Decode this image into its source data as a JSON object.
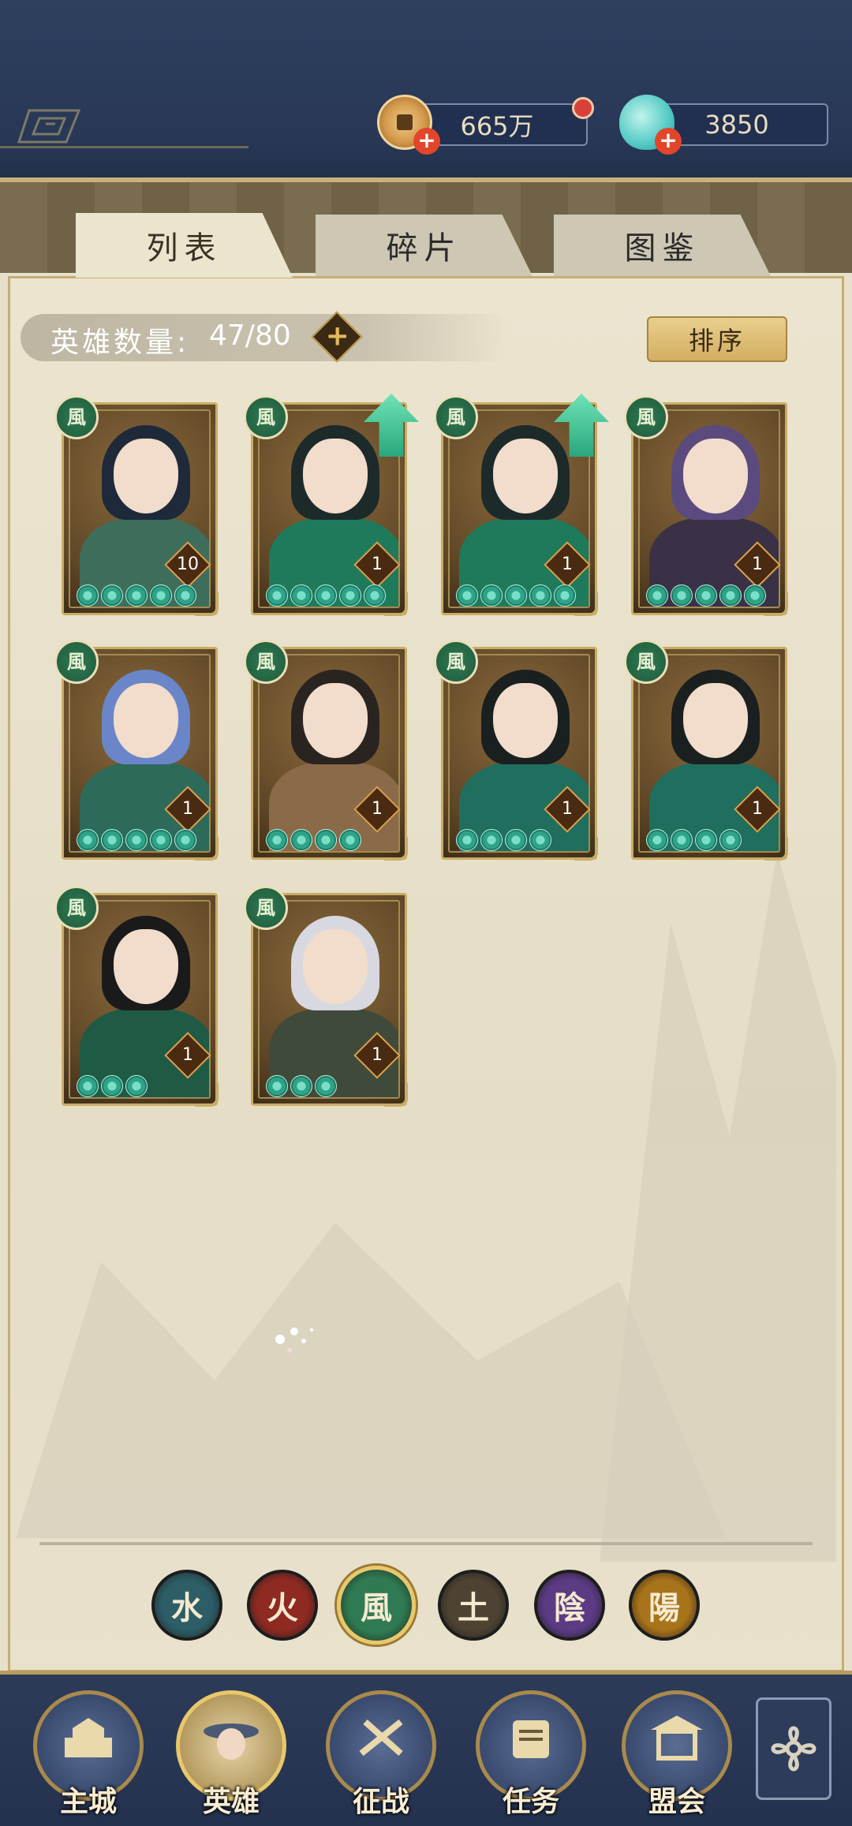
{
  "currency": {
    "coins": "665万",
    "jade": "3850"
  },
  "tabs": [
    {
      "label": "列表",
      "active": true
    },
    {
      "label": "碎片",
      "active": false
    },
    {
      "label": "图鉴",
      "active": false
    }
  ],
  "hero_count": {
    "label": "英雄数量:",
    "value": "47/80"
  },
  "sort_label": "排序",
  "heroes": [
    {
      "element": "風",
      "level": "10",
      "stars": 5,
      "upgrade": false,
      "hair": "#1e2a3a",
      "body": "#3f6d5b"
    },
    {
      "element": "風",
      "level": "1",
      "stars": 5,
      "upgrade": true,
      "hair": "#1d2a2a",
      "body": "#1f7a5c"
    },
    {
      "element": "風",
      "level": "1",
      "stars": 5,
      "upgrade": true,
      "hair": "#1d2a2a",
      "body": "#1f7a5c"
    },
    {
      "element": "風",
      "level": "1",
      "stars": 5,
      "upgrade": false,
      "hair": "#5b4a7e",
      "body": "#3a3147"
    },
    {
      "element": "風",
      "level": "1",
      "stars": 5,
      "upgrade": false,
      "hair": "#6a86c8",
      "body": "#2e6a5a"
    },
    {
      "element": "風",
      "level": "1",
      "stars": 4,
      "upgrade": false,
      "hair": "#2a2420",
      "body": "#8a6a48"
    },
    {
      "element": "風",
      "level": "1",
      "stars": 4,
      "upgrade": false,
      "hair": "#1a1f1f",
      "body": "#1f6e5e"
    },
    {
      "element": "風",
      "level": "1",
      "stars": 4,
      "upgrade": false,
      "hair": "#1a1f1f",
      "body": "#1f6e5e"
    },
    {
      "element": "風",
      "level": "1",
      "stars": 3,
      "upgrade": false,
      "hair": "#1a1a1a",
      "body": "#1f5a44"
    },
    {
      "element": "風",
      "level": "1",
      "stars": 3,
      "upgrade": false,
      "hair": "#d8d8e0",
      "body": "#3f4a3a"
    }
  ],
  "element_filters": [
    {
      "glyph": "水",
      "color": "#2d5d67",
      "selected": false
    },
    {
      "glyph": "火",
      "color": "#8e2a22",
      "selected": false
    },
    {
      "glyph": "風",
      "color": "#2f7a52",
      "selected": true
    },
    {
      "glyph": "土",
      "color": "#4e4332",
      "selected": false
    },
    {
      "glyph": "陰",
      "color": "#5b3b84",
      "selected": false
    },
    {
      "glyph": "陽",
      "color": "#a8731a",
      "selected": false
    }
  ],
  "nav": [
    {
      "label": "主城",
      "icon": "castle-icon",
      "active": false
    },
    {
      "label": "英雄",
      "icon": "hero-portrait-icon",
      "active": true
    },
    {
      "label": "征战",
      "icon": "battle-icon",
      "active": false
    },
    {
      "label": "任务",
      "icon": "scroll-icon",
      "active": false
    },
    {
      "label": "盟会",
      "icon": "pavilion-icon",
      "active": false
    }
  ]
}
